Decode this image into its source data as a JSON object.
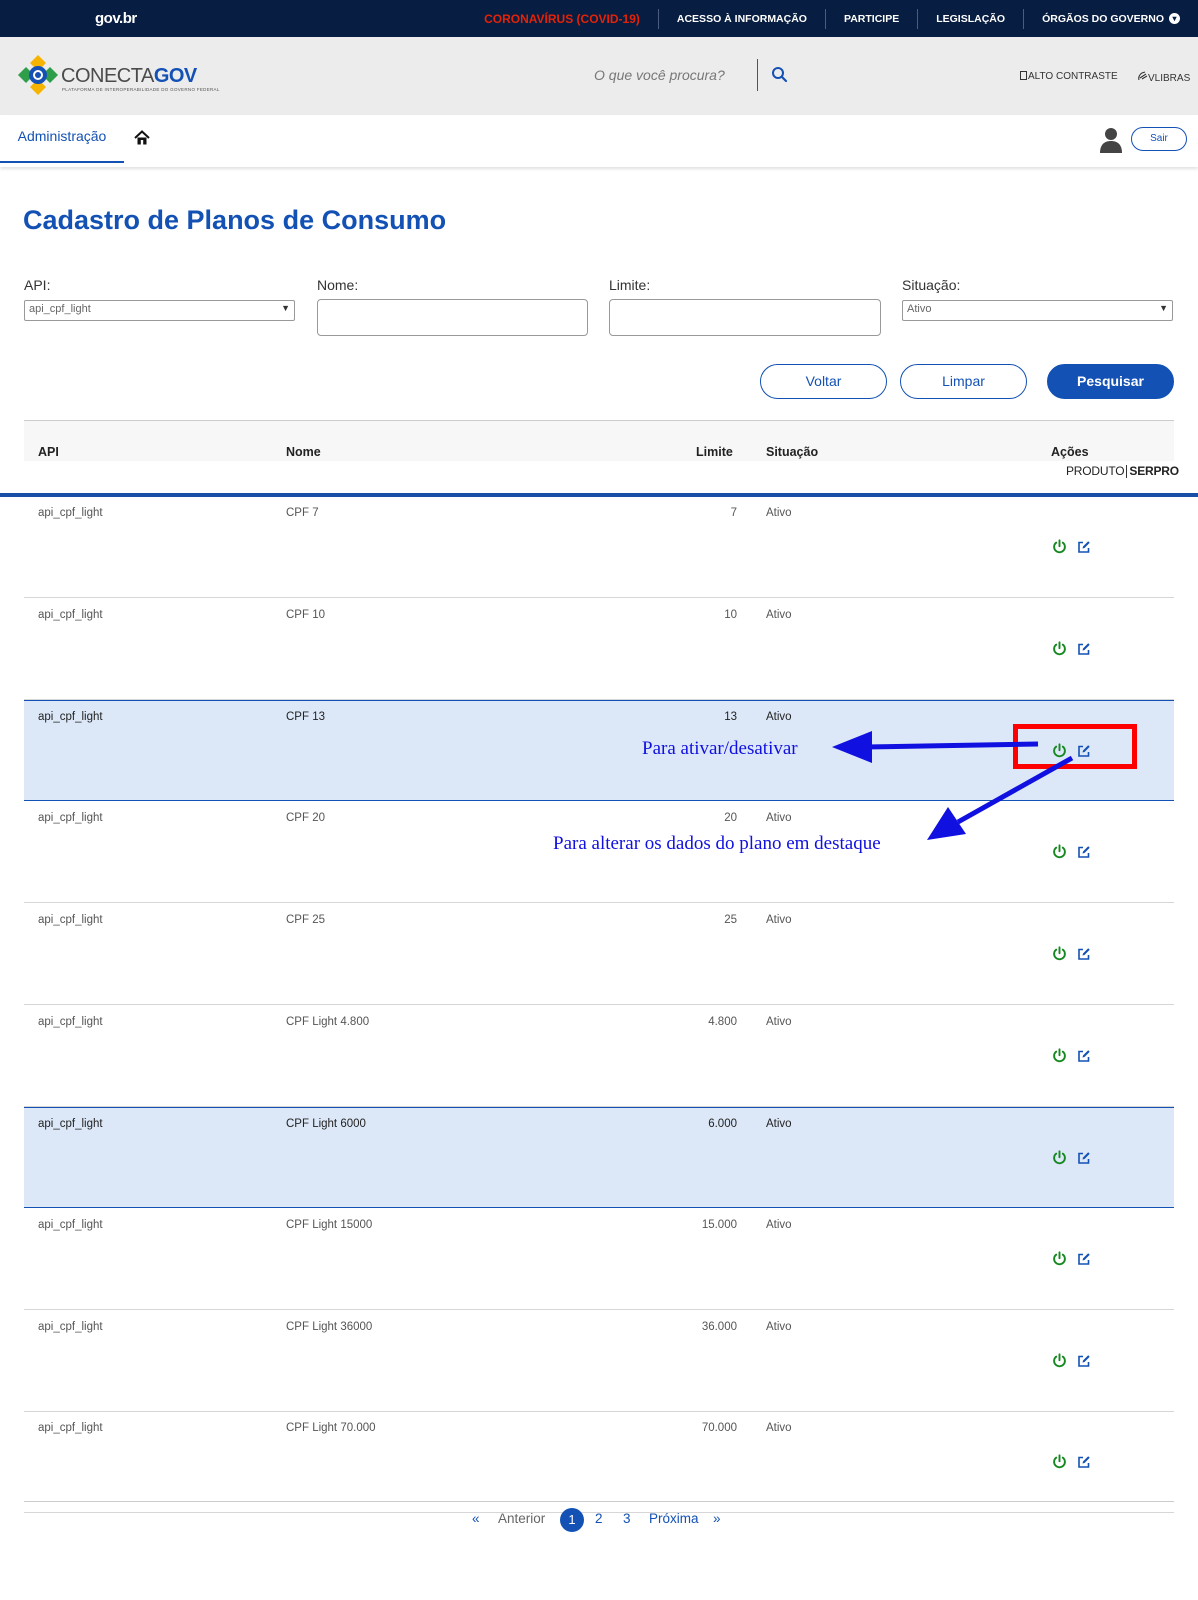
{
  "govbar": {
    "logo": "gov.br",
    "links": [
      "CORONAVÍRUS (COVID-19)",
      "ACESSO À INFORMAÇÃO",
      "PARTICIPE",
      "LEGISLAÇÃO",
      "ÓRGÃOS DO GOVERNO"
    ]
  },
  "header": {
    "logo_main": "CONECTA",
    "logo_bold": "GOV",
    "logo_sub": "PLATAFORMA DE INTEROPERABILIDADE DO GOVERNO FEDERAL",
    "search_placeholder": "O que você procura?",
    "alto_contraste": "ALTO CONTRASTE",
    "vlibras": "VLIBRAS"
  },
  "nav": {
    "tab_admin": "Administração",
    "sair": "Sair"
  },
  "page": {
    "title": "Cadastro de Planos de Consumo"
  },
  "filters": {
    "api_label": "API:",
    "api_value": "api_cpf_light",
    "nome_label": "Nome:",
    "limite_label": "Limite:",
    "situacao_label": "Situação:",
    "situacao_value": "Ativo"
  },
  "buttons": {
    "voltar": "Voltar",
    "limpar": "Limpar",
    "pesquisar": "Pesquisar"
  },
  "table": {
    "headers": {
      "api": "API",
      "nome": "Nome",
      "limite": "Limite",
      "situacao": "Situação",
      "acoes": "Ações"
    },
    "rows": [
      {
        "api": "api_cpf_light",
        "nome": "CPF 7",
        "limite": "7",
        "situacao": "Ativo"
      },
      {
        "api": "api_cpf_light",
        "nome": "CPF 10",
        "limite": "10",
        "situacao": "Ativo"
      },
      {
        "api": "api_cpf_light",
        "nome": "CPF 13",
        "limite": "13",
        "situacao": "Ativo"
      },
      {
        "api": "api_cpf_light",
        "nome": "CPF 20",
        "limite": "20",
        "situacao": "Ativo"
      },
      {
        "api": "api_cpf_light",
        "nome": "CPF 25",
        "limite": "25",
        "situacao": "Ativo"
      },
      {
        "api": "api_cpf_light",
        "nome": "CPF Light 4.800",
        "limite": "4.800",
        "situacao": "Ativo"
      },
      {
        "api": "api_cpf_light",
        "nome": "CPF Light 6000",
        "limite": "6.000",
        "situacao": "Ativo"
      },
      {
        "api": "api_cpf_light",
        "nome": "CPF Light 15000",
        "limite": "15.000",
        "situacao": "Ativo"
      },
      {
        "api": "api_cpf_light",
        "nome": "CPF Light 36000",
        "limite": "36.000",
        "situacao": "Ativo"
      },
      {
        "api": "api_cpf_light",
        "nome": "CPF Light 70.000",
        "limite": "70.000",
        "situacao": "Ativo"
      }
    ],
    "highlighted_rows": [
      2,
      6
    ]
  },
  "produto": {
    "produto": "PRODUTO",
    "serpro": "SERPRO"
  },
  "pagination": {
    "anterior": "Anterior",
    "pages": [
      "1",
      "2",
      "3"
    ],
    "current": "1",
    "proxima": "Próxima"
  },
  "annotations": {
    "ativar": "Para ativar/desativar",
    "alterar": "Para alterar os dados do plano em destaque"
  },
  "colors": {
    "primary": "#1351b4",
    "govbar": "#071d41",
    "covid": "#e52207",
    "power_icon": "#168821",
    "highlight_row": "#dce8f8",
    "annotation_box": "#ff0000",
    "annotation_text": "#1010e0"
  }
}
